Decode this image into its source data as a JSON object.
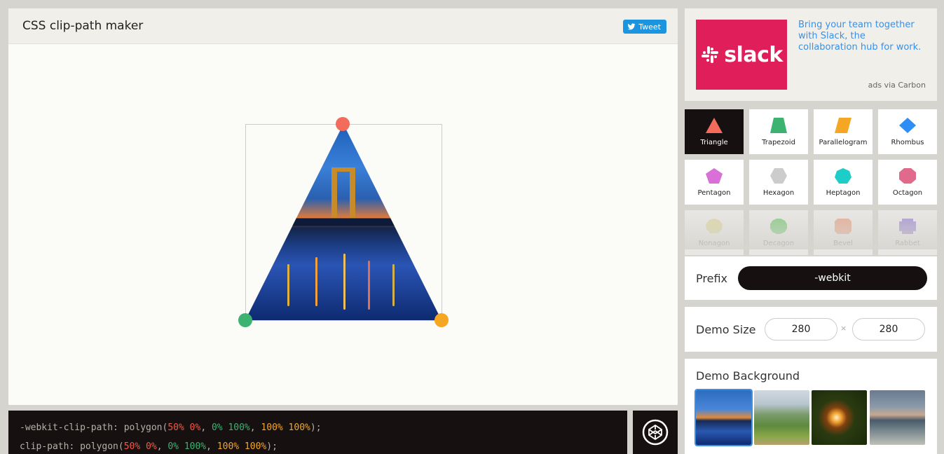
{
  "header": {
    "title": "CSS clip-path maker",
    "tweet_label": "Tweet"
  },
  "demo": {
    "handles": [
      {
        "name": "point-1-handle",
        "color": "#f26b5b"
      },
      {
        "name": "point-2-handle",
        "color": "#3cb371"
      },
      {
        "name": "point-3-handle",
        "color": "#f5a623"
      }
    ]
  },
  "code": {
    "line1": {
      "property": "-webkit-clip-path: ",
      "fn_open": "polygon(",
      "p1": "50% 0%",
      "sep1": ", ",
      "p2": "0% 100%",
      "sep2": ", ",
      "p3": "100% 100%",
      "close": ");"
    },
    "line2": {
      "property": "clip-path: ",
      "fn_open": "polygon(",
      "p1": "50% 0%",
      "sep1": ", ",
      "p2": "0% 100%",
      "sep2": ", ",
      "p3": "100% 100%",
      "close": ");"
    }
  },
  "ad": {
    "brand": "slack",
    "text": "Bring your team together with Slack, the collaboration hub for work.",
    "via": "ads via Carbon"
  },
  "shapes": [
    {
      "label": "Triangle",
      "color": "#f26b5b",
      "icon": "triangle-icon"
    },
    {
      "label": "Trapezoid",
      "color": "#3cb371",
      "icon": "trapezoid-icon"
    },
    {
      "label": "Parallelogram",
      "color": "#f5a623",
      "icon": "parallelogram-icon"
    },
    {
      "label": "Rhombus",
      "color": "#2e8ef5",
      "icon": "rhombus-icon"
    },
    {
      "label": "Pentagon",
      "color": "#da6fd8",
      "icon": "pentagon-icon"
    },
    {
      "label": "Hexagon",
      "color": "#cccccc",
      "icon": "hexagon-icon"
    },
    {
      "label": "Heptagon",
      "color": "#1ccdc8",
      "icon": "heptagon-icon"
    },
    {
      "label": "Octagon",
      "color": "#e0698c",
      "icon": "octagon-icon"
    },
    {
      "label": "Nonagon",
      "color": "#e8df7a",
      "icon": "nonagon-icon"
    },
    {
      "label": "Decagon",
      "color": "#3cc43c",
      "icon": "decagon-icon"
    },
    {
      "label": "Bevel",
      "color": "#f5865b",
      "icon": "bevel-icon"
    },
    {
      "label": "Rabbet",
      "color": "#7b5bd6",
      "icon": "rabbet-icon"
    }
  ],
  "prefix": {
    "label": "Prefix",
    "value": "-webkit"
  },
  "demo_size": {
    "label": "Demo Size",
    "width": "280",
    "height": "280",
    "separator": "×"
  },
  "demo_background": {
    "label": "Demo Background",
    "thumbnails": [
      "bridge-night",
      "hills-landscape",
      "sparkler",
      "ocean-waves"
    ]
  }
}
